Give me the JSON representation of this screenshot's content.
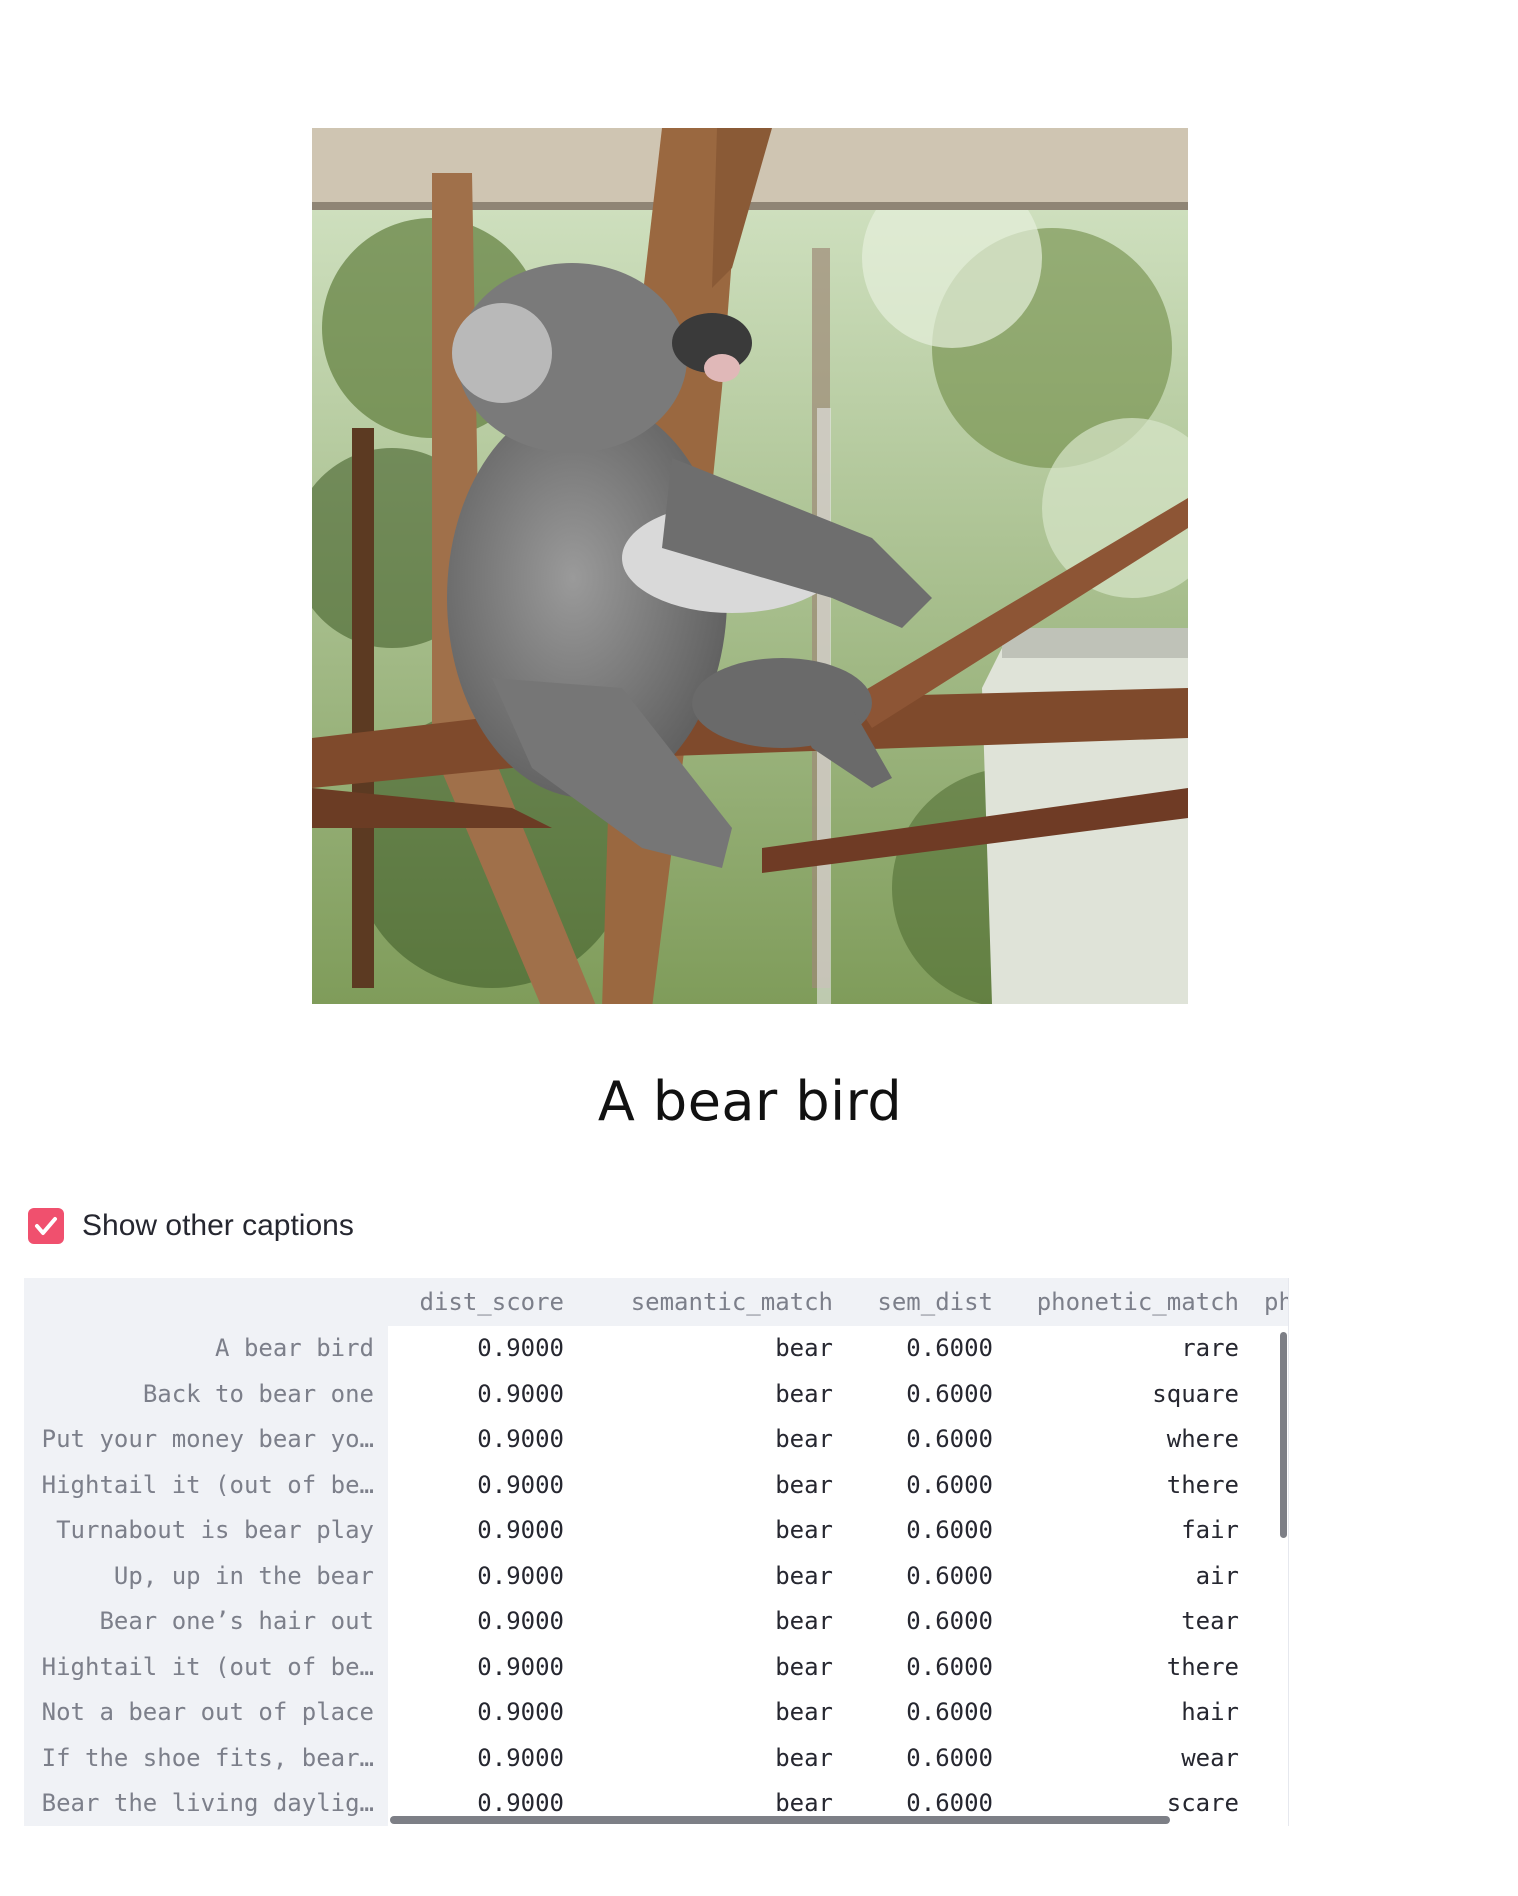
{
  "caption": "A bear bird",
  "image": {
    "subject": "koala-photo"
  },
  "toggle": {
    "label": "Show other captions",
    "checked": true,
    "color": "#f0506e"
  },
  "table": {
    "columns": [
      "dist_score",
      "semantic_match",
      "sem_dist",
      "phonetic_match",
      "ph"
    ],
    "rows": [
      {
        "index": "A bear bird",
        "dist_score": "0.9000",
        "semantic_match": "bear",
        "sem_dist": "0.6000",
        "phonetic_match": "rare"
      },
      {
        "index": "Back to bear one",
        "dist_score": "0.9000",
        "semantic_match": "bear",
        "sem_dist": "0.6000",
        "phonetic_match": "square"
      },
      {
        "index": "Put your money bear yo…",
        "dist_score": "0.9000",
        "semantic_match": "bear",
        "sem_dist": "0.6000",
        "phonetic_match": "where"
      },
      {
        "index": "Hightail it (out of be…",
        "dist_score": "0.9000",
        "semantic_match": "bear",
        "sem_dist": "0.6000",
        "phonetic_match": "there"
      },
      {
        "index": "Turnabout is bear play",
        "dist_score": "0.9000",
        "semantic_match": "bear",
        "sem_dist": "0.6000",
        "phonetic_match": "fair"
      },
      {
        "index": "Up, up in the bear",
        "dist_score": "0.9000",
        "semantic_match": "bear",
        "sem_dist": "0.6000",
        "phonetic_match": "air"
      },
      {
        "index": "Bear one’s hair out",
        "dist_score": "0.9000",
        "semantic_match": "bear",
        "sem_dist": "0.6000",
        "phonetic_match": "tear"
      },
      {
        "index": "Hightail it (out of be…",
        "dist_score": "0.9000",
        "semantic_match": "bear",
        "sem_dist": "0.6000",
        "phonetic_match": "there"
      },
      {
        "index": "Not a bear out of place",
        "dist_score": "0.9000",
        "semantic_match": "bear",
        "sem_dist": "0.6000",
        "phonetic_match": "hair"
      },
      {
        "index": "If the shoe fits, bear…",
        "dist_score": "0.9000",
        "semantic_match": "bear",
        "sem_dist": "0.6000",
        "phonetic_match": "wear"
      },
      {
        "index": "Bear the living daylig…",
        "dist_score": "0.9000",
        "semantic_match": "bear",
        "sem_dist": "0.6000",
        "phonetic_match": "scare"
      }
    ]
  }
}
